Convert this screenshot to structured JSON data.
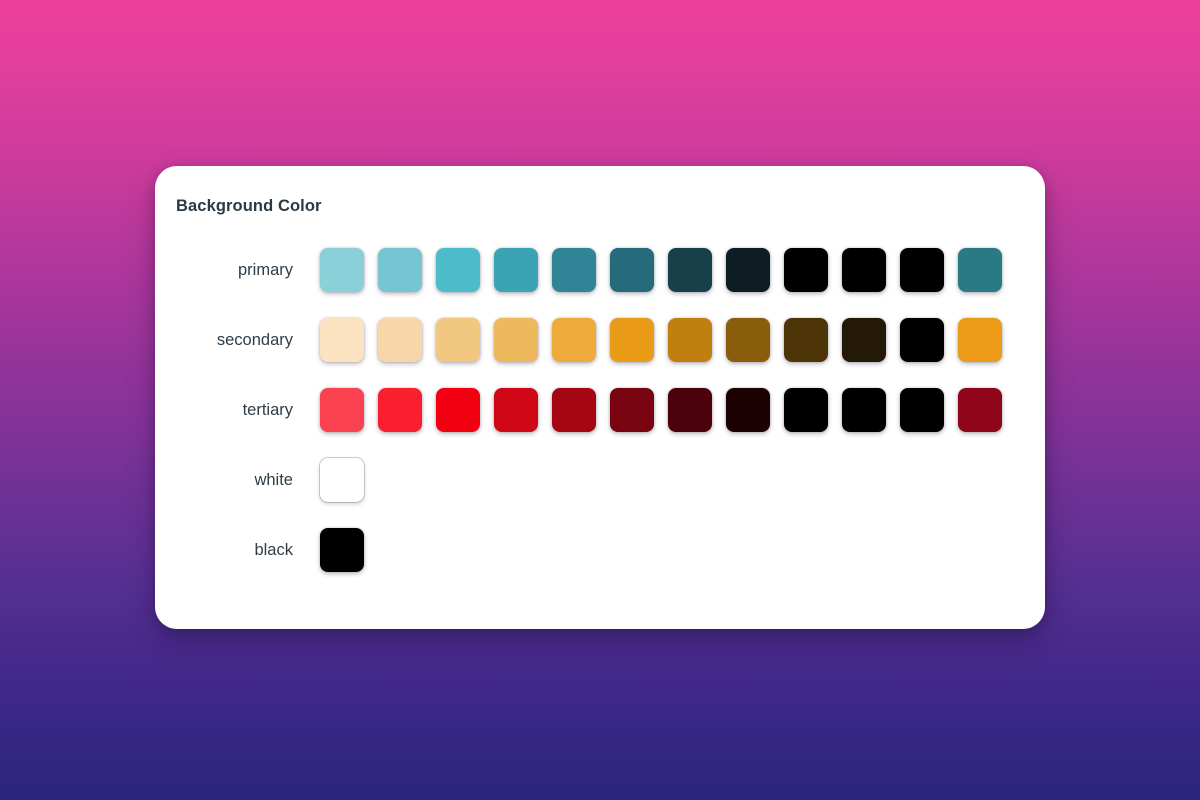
{
  "background": {
    "gradient_from": "#ec3f9a",
    "gradient_mid": "#8a3399",
    "gradient_to": "#2c2580"
  },
  "card": {
    "title": "Background Color",
    "background_color": "#ffffff"
  },
  "rows": [
    {
      "label": "primary",
      "swatches": [
        {
          "color": "#8bcfd8"
        },
        {
          "color": "#75c6d2"
        },
        {
          "color": "#4cbcca"
        },
        {
          "color": "#3aa3b4"
        },
        {
          "color": "#2f8597"
        },
        {
          "color": "#256b7c"
        },
        {
          "color": "#18404b"
        },
        {
          "color": "#0d1d23"
        },
        {
          "color": "#000000"
        },
        {
          "color": "#000000"
        },
        {
          "color": "#000000"
        },
        {
          "color": "#2a7a85"
        }
      ]
    },
    {
      "label": "secondary",
      "swatches": [
        {
          "color": "#fbe3c1"
        },
        {
          "color": "#f7d7a8"
        },
        {
          "color": "#f2c880"
        },
        {
          "color": "#eeb85c"
        },
        {
          "color": "#eeab3a"
        },
        {
          "color": "#e99a16"
        },
        {
          "color": "#bf800f"
        },
        {
          "color": "#8a5d0d"
        },
        {
          "color": "#4e3508"
        },
        {
          "color": "#241806"
        },
        {
          "color": "#000000"
        },
        {
          "color": "#eb9b18"
        }
      ]
    },
    {
      "label": "tertiary",
      "swatches": [
        {
          "color": "#f9414f"
        },
        {
          "color": "#f91f2e"
        },
        {
          "color": "#f20011"
        },
        {
          "color": "#d00716"
        },
        {
          "color": "#a50614"
        },
        {
          "color": "#780410"
        },
        {
          "color": "#4b020a"
        },
        {
          "color": "#1d0204"
        },
        {
          "color": "#000000"
        },
        {
          "color": "#000000"
        },
        {
          "color": "#000000"
        },
        {
          "color": "#8f0519"
        }
      ]
    },
    {
      "label": "white",
      "swatches": [
        {
          "color": "#ffffff",
          "bordered": true
        }
      ]
    },
    {
      "label": "black",
      "swatches": [
        {
          "color": "#000000"
        }
      ]
    }
  ]
}
